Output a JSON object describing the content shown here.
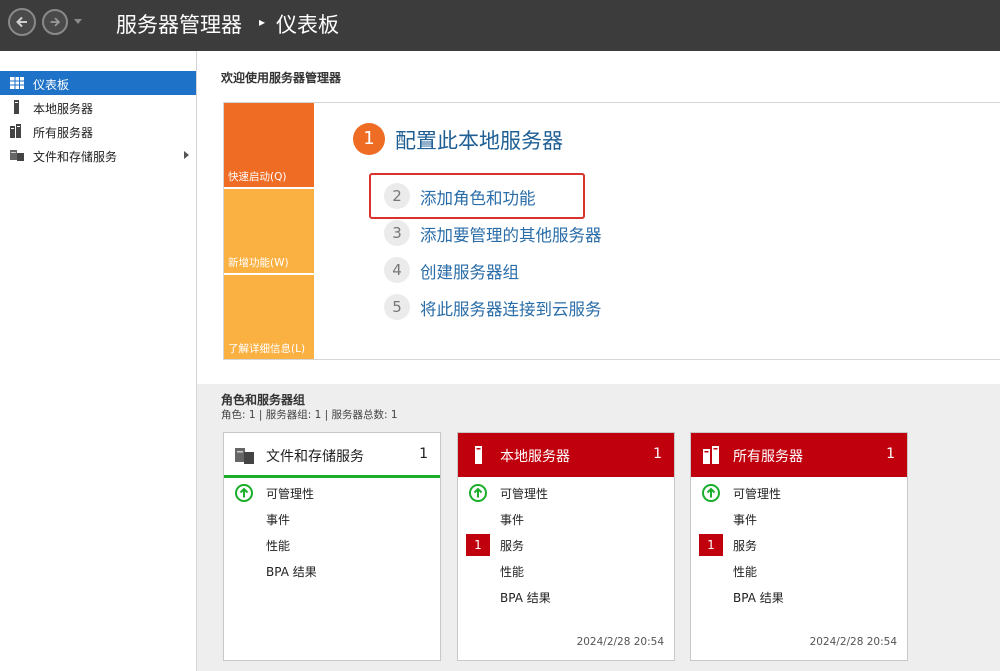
{
  "titlebar": {
    "app_title": "服务器管理器",
    "separator": "▸",
    "page_title": "仪表板"
  },
  "sidebar": {
    "items": [
      {
        "label": "仪表板",
        "icon": "dashboard-icon",
        "active": true
      },
      {
        "label": "本地服务器",
        "icon": "server-icon"
      },
      {
        "label": "所有服务器",
        "icon": "servers-icon"
      },
      {
        "label": "文件和存储服务",
        "icon": "file-storage-icon",
        "has_submenu": true
      }
    ]
  },
  "welcome": {
    "title": "欢迎使用服务器管理器",
    "tiles": [
      {
        "label": "快速启动(Q)"
      },
      {
        "label": "新增功能(W)"
      },
      {
        "label": "了解详细信息(L)"
      }
    ],
    "steps": [
      {
        "num": "1",
        "label": "配置此本地服务器"
      },
      {
        "num": "2",
        "label": "添加角色和功能"
      },
      {
        "num": "3",
        "label": "添加要管理的其他服务器"
      },
      {
        "num": "4",
        "label": "创建服务器组"
      },
      {
        "num": "5",
        "label": "将此服务器连接到云服务"
      }
    ]
  },
  "roles": {
    "title": "角色和服务器组",
    "summary": "角色: 1 | 服务器组: 1 | 服务器总数: 1",
    "cards": [
      {
        "title": "文件和存储服务",
        "count": "1",
        "rows": [
          "可管理性",
          "事件",
          "性能",
          "BPA 结果"
        ],
        "timestamp": ""
      },
      {
        "title": "本地服务器",
        "count": "1",
        "rows": [
          "可管理性",
          "事件",
          "服务",
          "性能",
          "BPA 结果"
        ],
        "service_badge": "1",
        "timestamp": "2024/2/28 20:54"
      },
      {
        "title": "所有服务器",
        "count": "1",
        "rows": [
          "可管理性",
          "事件",
          "服务",
          "性能",
          "BPA 结果"
        ],
        "service_badge": "1",
        "timestamp": "2024/2/28 20:54"
      }
    ]
  },
  "colors": {
    "titlebar_bg": "#3c3c3c",
    "active_nav": "#1e72c7",
    "quickstart_orange": "#ef6c24",
    "tile_yellow": "#fbb142",
    "alert_red": "#c1000e",
    "ok_green": "#1aae2b",
    "highlight_red": "#d9322c",
    "link_blue": "#2a6da8"
  }
}
